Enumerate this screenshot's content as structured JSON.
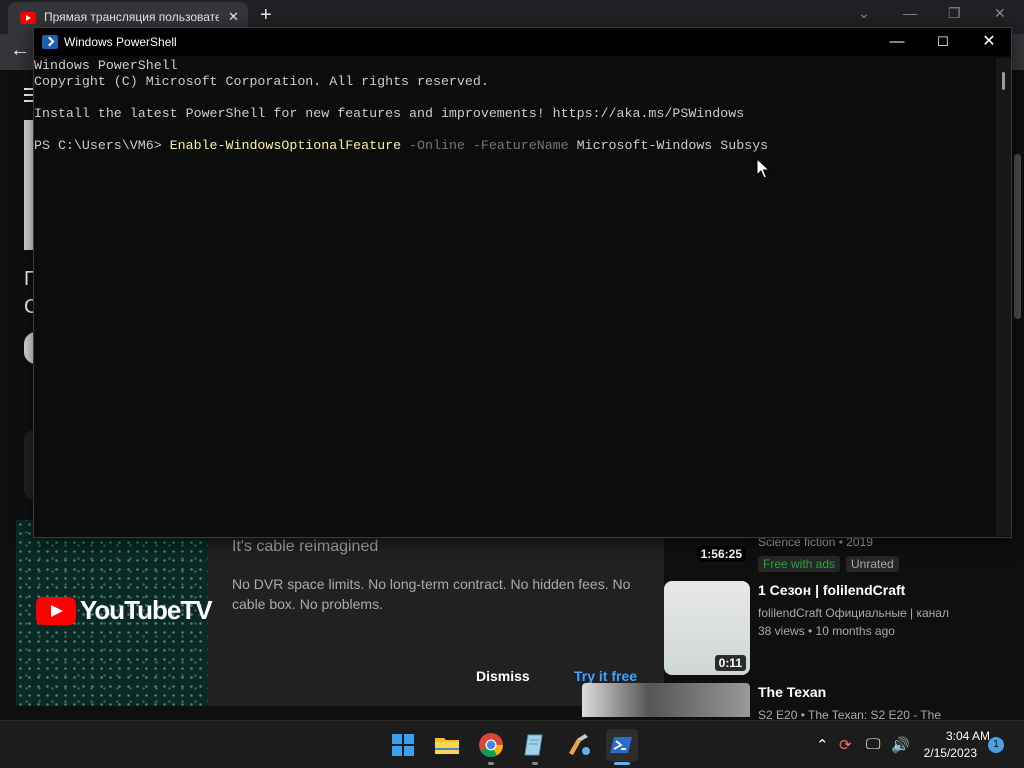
{
  "browser": {
    "tab_title": "Прямая трансляция пользовате",
    "tab_close": "✕",
    "new_tab": "+",
    "back": "←",
    "window_controls": [
      "⌄",
      "—",
      "❐",
      "✕"
    ]
  },
  "youtube": {
    "left_letters": [
      "П",
      "С"
    ],
    "promo": {
      "logo_text": "YouTubeTV",
      "heading": "It's cable reimagined",
      "body": "No DVR space limits. No long-term contract. No hidden fees. No cable box. No problems.",
      "dismiss_label": "Dismiss",
      "try_label": "Try it free"
    },
    "recommendations": [
      {
        "duration": "1:56:25",
        "meta": "Science fiction • 2019",
        "chips": [
          "Free with ads",
          "Unrated"
        ]
      },
      {
        "duration": "0:11",
        "title": "1 Сезон | folilendCraft",
        "channel": "folilendCraft Официальные | канал",
        "stats": "38 views  • 10 months ago"
      },
      {
        "title": "The Texan",
        "meta": "S2 E20 • The Texan: S2 E20 - The"
      }
    ]
  },
  "powershell": {
    "title": "Windows PowerShell",
    "controls": {
      "minimize": "—",
      "maximize": "☐",
      "close": "✕"
    },
    "lines": [
      "Windows PowerShell",
      "Copyright (C) Microsoft Corporation. All rights reserved.",
      "Install the latest PowerShell for new features and improvements! https://aka.ms/PSWindows"
    ],
    "prompt": "PS C:\\Users\\VM6> ",
    "command": {
      "name": "Enable-WindowsOptionalFeature",
      "param1": "-Online",
      "param2": "-FeatureName",
      "value": "Microsoft-Windows Subsys"
    }
  },
  "taskbar": {
    "apps": [
      "start-icon",
      "file-explorer-icon",
      "chrome-icon",
      "notepad-icon",
      "paint-icon",
      "powershell-icon"
    ],
    "tray": {
      "chevron": "⌃",
      "update": "⟳",
      "network": "🖵",
      "volume": "🔊"
    },
    "time": "3:04 AM",
    "date": "2/15/2023",
    "notifications": "1"
  },
  "colors": {
    "console_bg": "#0c0c0c",
    "console_text": "#cccccc",
    "cmd_name": "#f9f1a5",
    "cmd_param": "#767676",
    "youtube_red": "#ff0000",
    "link_blue": "#3ea6ff"
  }
}
